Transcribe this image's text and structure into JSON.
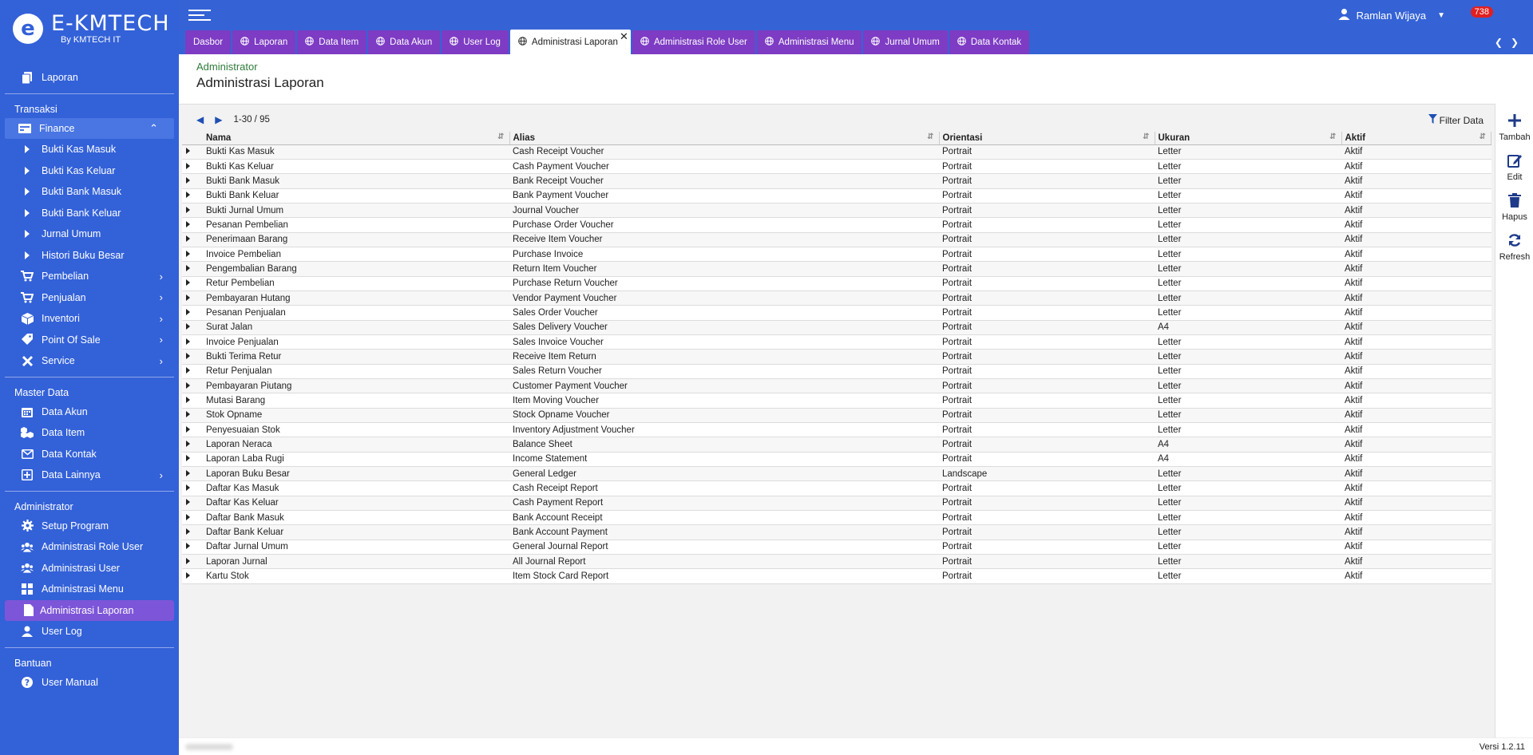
{
  "app": {
    "logo_letter": "e",
    "title": "E-KMTECH",
    "subtitle": "By KMTECH IT",
    "version": "Versi 1.2.11"
  },
  "header": {
    "user_name": "Ramlan Wijaya",
    "notification_count": "738"
  },
  "tabs": [
    {
      "label": "Dasbor"
    },
    {
      "label": "Laporan"
    },
    {
      "label": "Data Item"
    },
    {
      "label": "Data Akun"
    },
    {
      "label": "User Log"
    },
    {
      "label": "Administrasi Laporan"
    },
    {
      "label": "Administrasi Role User"
    },
    {
      "label": "Administrasi Menu"
    },
    {
      "label": "Jurnal Umum"
    },
    {
      "label": "Data Kontak"
    }
  ],
  "sidebar": {
    "top_item": "Laporan",
    "sections": {
      "transaksi": "Transaksi",
      "master": "Master Data",
      "admin": "Administrator",
      "bantuan": "Bantuan"
    },
    "finance": "Finance",
    "finance_items": [
      "Bukti Kas Masuk",
      "Bukti Kas Keluar",
      "Bukti Bank Masuk",
      "Bukti Bank Keluar",
      "Jurnal Umum",
      "Histori Buku Besar"
    ],
    "transaksi_items": [
      "Pembelian",
      "Penjualan",
      "Inventori",
      "Point Of Sale",
      "Service"
    ],
    "master_items": [
      "Data Akun",
      "Data Item",
      "Data Kontak",
      "Data Lainnya"
    ],
    "admin_items": [
      "Setup Program",
      "Administrasi Role User",
      "Administrasi User",
      "Administrasi Menu",
      "Administrasi Laporan",
      "User Log"
    ],
    "bantuan_items": [
      "User Manual"
    ]
  },
  "page": {
    "breadcrumb": "Administrator",
    "title": "Administrasi Laporan",
    "pager": "1-30 / 95",
    "filter_label": "Filter Data"
  },
  "table": {
    "columns": [
      "Nama",
      "Alias",
      "Orientasi",
      "Ukuran",
      "Aktif"
    ],
    "rows": [
      [
        "Bukti Kas Masuk",
        "Cash Receipt Voucher",
        "Portrait",
        "Letter",
        "Aktif"
      ],
      [
        "Bukti Kas Keluar",
        "Cash Payment Voucher",
        "Portrait",
        "Letter",
        "Aktif"
      ],
      [
        "Bukti Bank Masuk",
        "Bank Receipt Voucher",
        "Portrait",
        "Letter",
        "Aktif"
      ],
      [
        "Bukti Bank Keluar",
        "Bank Payment Voucher",
        "Portrait",
        "Letter",
        "Aktif"
      ],
      [
        "Bukti Jurnal Umum",
        "Journal Voucher",
        "Portrait",
        "Letter",
        "Aktif"
      ],
      [
        "Pesanan Pembelian",
        "Purchase Order Voucher",
        "Portrait",
        "Letter",
        "Aktif"
      ],
      [
        "Penerimaan Barang",
        "Receive Item Voucher",
        "Portrait",
        "Letter",
        "Aktif"
      ],
      [
        "Invoice Pembelian",
        "Purchase Invoice",
        "Portrait",
        "Letter",
        "Aktif"
      ],
      [
        "Pengembalian Barang",
        "Return Item Voucher",
        "Portrait",
        "Letter",
        "Aktif"
      ],
      [
        "Retur Pembelian",
        "Purchase Return Voucher",
        "Portrait",
        "Letter",
        "Aktif"
      ],
      [
        "Pembayaran Hutang",
        "Vendor Payment Voucher",
        "Portrait",
        "Letter",
        "Aktif"
      ],
      [
        "Pesanan Penjualan",
        "Sales Order Voucher",
        "Portrait",
        "Letter",
        "Aktif"
      ],
      [
        "Surat Jalan",
        "Sales Delivery Voucher",
        "Portrait",
        "A4",
        "Aktif"
      ],
      [
        "Invoice Penjualan",
        "Sales Invoice Voucher",
        "Portrait",
        "Letter",
        "Aktif"
      ],
      [
        "Bukti Terima Retur",
        "Receive Item Return",
        "Portrait",
        "Letter",
        "Aktif"
      ],
      [
        "Retur Penjualan",
        "Sales Return Voucher",
        "Portrait",
        "Letter",
        "Aktif"
      ],
      [
        "Pembayaran Piutang",
        "Customer Payment Voucher",
        "Portrait",
        "Letter",
        "Aktif"
      ],
      [
        "Mutasi Barang",
        "Item Moving Voucher",
        "Portrait",
        "Letter",
        "Aktif"
      ],
      [
        "Stok Opname",
        "Stock Opname Voucher",
        "Portrait",
        "Letter",
        "Aktif"
      ],
      [
        "Penyesuaian Stok",
        "Inventory Adjustment Voucher",
        "Portrait",
        "Letter",
        "Aktif"
      ],
      [
        "Laporan Neraca",
        "Balance Sheet",
        "Portrait",
        "A4",
        "Aktif"
      ],
      [
        "Laporan Laba Rugi",
        "Income Statement",
        "Portrait",
        "A4",
        "Aktif"
      ],
      [
        "Laporan Buku Besar",
        "General Ledger",
        "Landscape",
        "Letter",
        "Aktif"
      ],
      [
        "Daftar Kas Masuk",
        "Cash Receipt Report",
        "Portrait",
        "Letter",
        "Aktif"
      ],
      [
        "Daftar Kas Keluar",
        "Cash Payment Report",
        "Portrait",
        "Letter",
        "Aktif"
      ],
      [
        "Daftar Bank Masuk",
        "Bank Account Receipt",
        "Portrait",
        "Letter",
        "Aktif"
      ],
      [
        "Daftar Bank Keluar",
        "Bank Account Payment",
        "Portrait",
        "Letter",
        "Aktif"
      ],
      [
        "Daftar Jurnal Umum",
        "General Journal Report",
        "Portrait",
        "Letter",
        "Aktif"
      ],
      [
        "Laporan Jurnal",
        "All Journal Report",
        "Portrait",
        "Letter",
        "Aktif"
      ],
      [
        "Kartu Stok",
        "Item Stock Card Report",
        "Portrait",
        "Letter",
        "Aktif"
      ]
    ]
  },
  "actions": [
    {
      "label": "Tambah",
      "icon": "plus-icon"
    },
    {
      "label": "Edit",
      "icon": "edit-icon"
    },
    {
      "label": "Hapus",
      "icon": "trash-icon"
    },
    {
      "label": "Refresh",
      "icon": "refresh-icon"
    }
  ],
  "colors": {
    "sidebar": "#3361d8",
    "tab": "#7d3cc3",
    "active_menu": "#7d55d8",
    "badge": "#e02020"
  }
}
